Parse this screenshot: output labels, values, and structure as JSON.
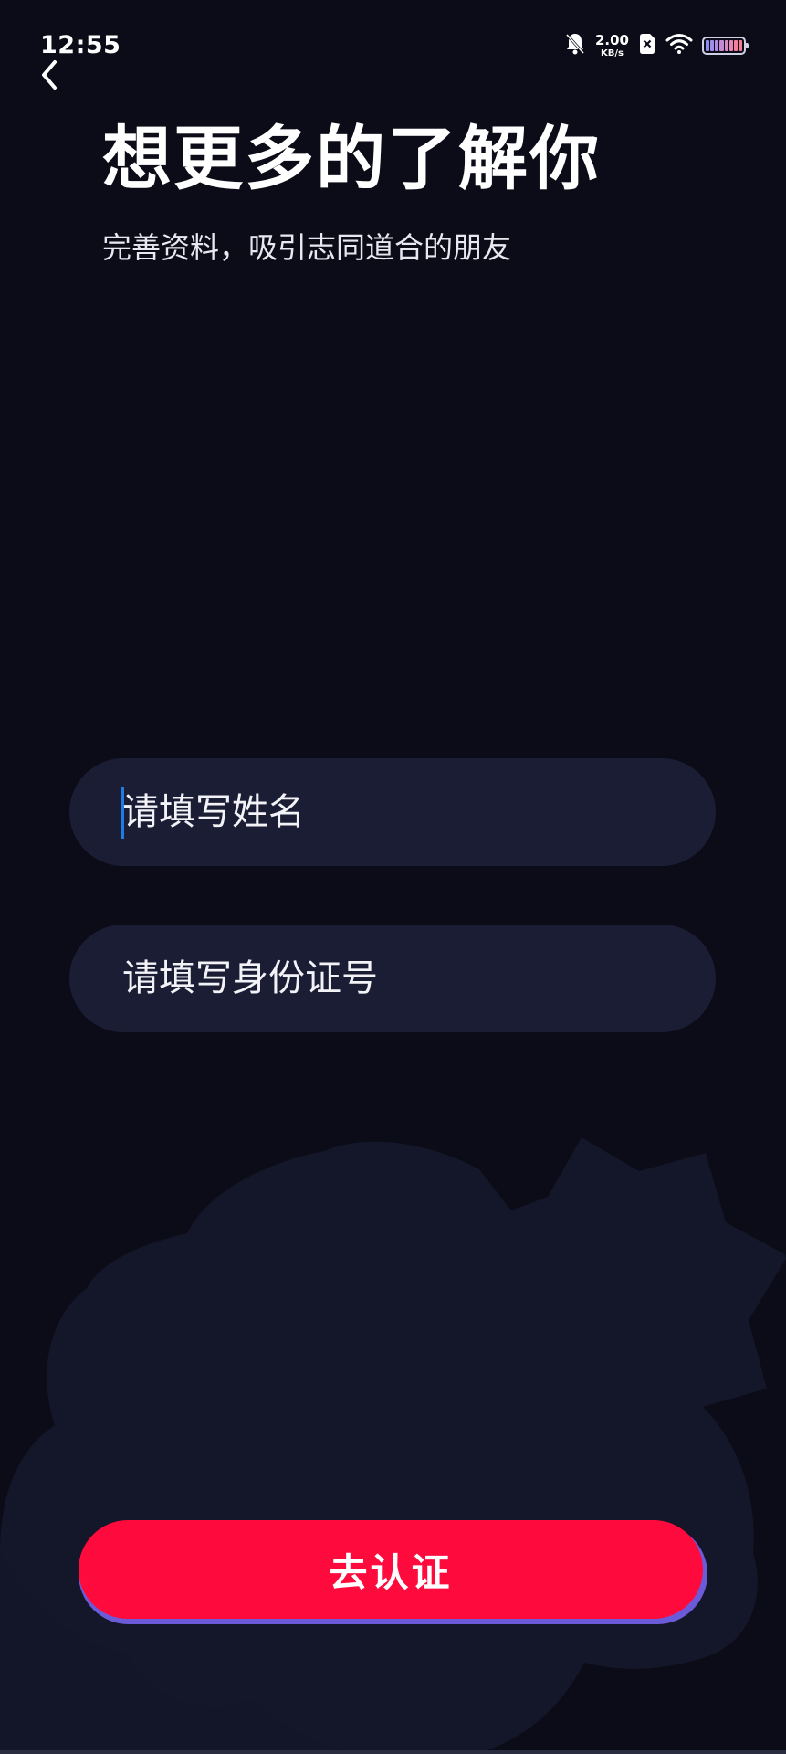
{
  "status_bar": {
    "time": "12:55",
    "net_speed_value": "2.00",
    "net_speed_unit": "KB/s",
    "icons": [
      "bell-muted-icon",
      "sim-off-icon",
      "wifi-icon",
      "battery-icon"
    ],
    "battery_level": 0.85
  },
  "header": {
    "back_icon": "chevron-left-icon",
    "title": "想更多的了解你",
    "subtitle": "完善资料，吸引志同道合的朋友"
  },
  "form": {
    "name_placeholder": "请填写姓名",
    "id_placeholder": "请填写身份证号"
  },
  "submit": {
    "label": "去认证"
  },
  "colors": {
    "background": "#0b0c17",
    "field_bg": "#1b1d35",
    "decor_blob": "#141629",
    "accent": "#ff0a3c",
    "accent_shadow": "#6c5bd8",
    "caret": "#1e7be6"
  }
}
